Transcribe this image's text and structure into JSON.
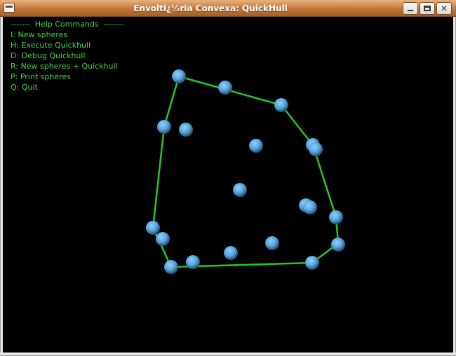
{
  "window": {
    "title": "Envolti¿½ria Convexa: QuickHull",
    "buttons": {
      "minimize": "minimize",
      "maximize": "maximize",
      "close": "✕"
    }
  },
  "help": {
    "header": "-------  Help Commands  -------",
    "commands": [
      "I: New spheres",
      "H: Execute Quickhull",
      "D: Debug Quickhull",
      "R: New spheres + Quickhull",
      "P: Print spheres",
      "Q: Quit"
    ]
  },
  "colors": {
    "hull": "#22c922",
    "sphere": "#5aa6dc",
    "help_text": "#45d245",
    "background": "#000000"
  }
}
